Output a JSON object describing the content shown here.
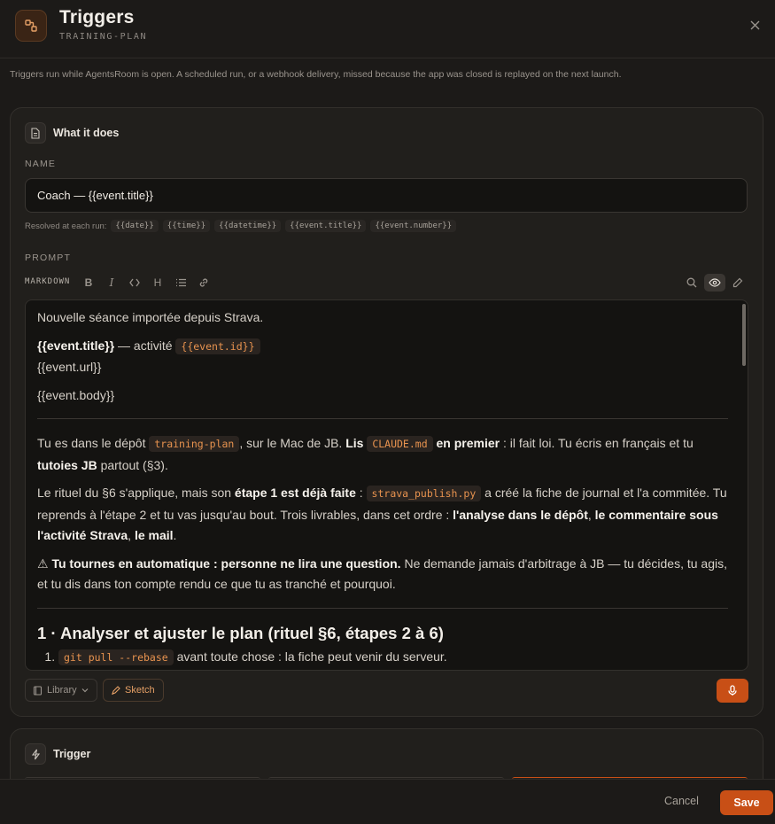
{
  "header": {
    "title": "Triggers",
    "subtitle": "TRAINING-PLAN"
  },
  "notice": "Triggers run while AgentsRoom is open. A scheduled run, or a webhook delivery, missed because the app was closed is replayed on the next launch.",
  "what_it_does": {
    "section_title": "What it does",
    "name_label": "NAME",
    "name_value": "Coach — {{event.title}}",
    "resolved_label": "Resolved at each run:",
    "variables": [
      "{{date}}",
      "{{time}}",
      "{{datetime}}",
      "{{event.title}}",
      "{{event.number}}"
    ],
    "prompt_label": "PROMPT",
    "markdown_label": "MARKDOWN"
  },
  "prompt": {
    "line1": "Nouvelle séance importée depuis Strava.",
    "event_title": "{{event.title}}",
    "activite": " — activité ",
    "event_id": "{{event.id}}",
    "event_url": "{{event.url}}",
    "event_body": "{{event.body}}",
    "p1_a": "Tu es dans le dépôt ",
    "p1_code1": "training-plan",
    "p1_b": ", sur le Mac de JB. ",
    "p1_bold1": "Lis",
    "p1_code2": "CLAUDE.md",
    "p1_bold2": "en premier",
    "p1_c": " : il fait loi. Tu écris en français et tu ",
    "p1_bold3": "tutoies JB",
    "p1_d": " partout (§3).",
    "p2_a": "Le rituel du §6 s'applique, mais son ",
    "p2_bold1": "étape 1 est déjà faite",
    "p2_b": " : ",
    "p2_code": "strava_publish.py",
    "p2_c": " a créé la fiche de journal et l'a commitée. Tu reprends à l'étape 2 et tu vas jusqu'au bout. Trois livrables, dans cet ordre : ",
    "p2_bold2": "l'analyse dans le dépôt",
    "p2_sep1": ", ",
    "p2_bold3": "le commentaire sous l'activité Strava",
    "p2_sep2": ", ",
    "p2_bold4": "le mail",
    "p2_end": ".",
    "p3_warn": "⚠ ",
    "p3_bold": "Tu tournes en automatique : personne ne lira une question.",
    "p3_rest": " Ne demande jamais d'arbitrage à JB — tu décides, tu agis, et tu dis dans ton compte rendu ce que tu as tranché et pourquoi.",
    "h1": "1 · Analyser et ajuster le plan (rituel §6, étapes 2 à 6)",
    "li1_code": "git pull --rebase",
    "li1_rest": " avant toute chose : la fiche peut venir du serveur."
  },
  "actions": {
    "library": "Library",
    "sketch": "Sketch"
  },
  "trigger": {
    "section_title": "Trigger"
  },
  "footer": {
    "cancel": "Cancel",
    "save": "Save"
  },
  "colors": {
    "accent": "#c84f16",
    "code": "#e8934f"
  }
}
